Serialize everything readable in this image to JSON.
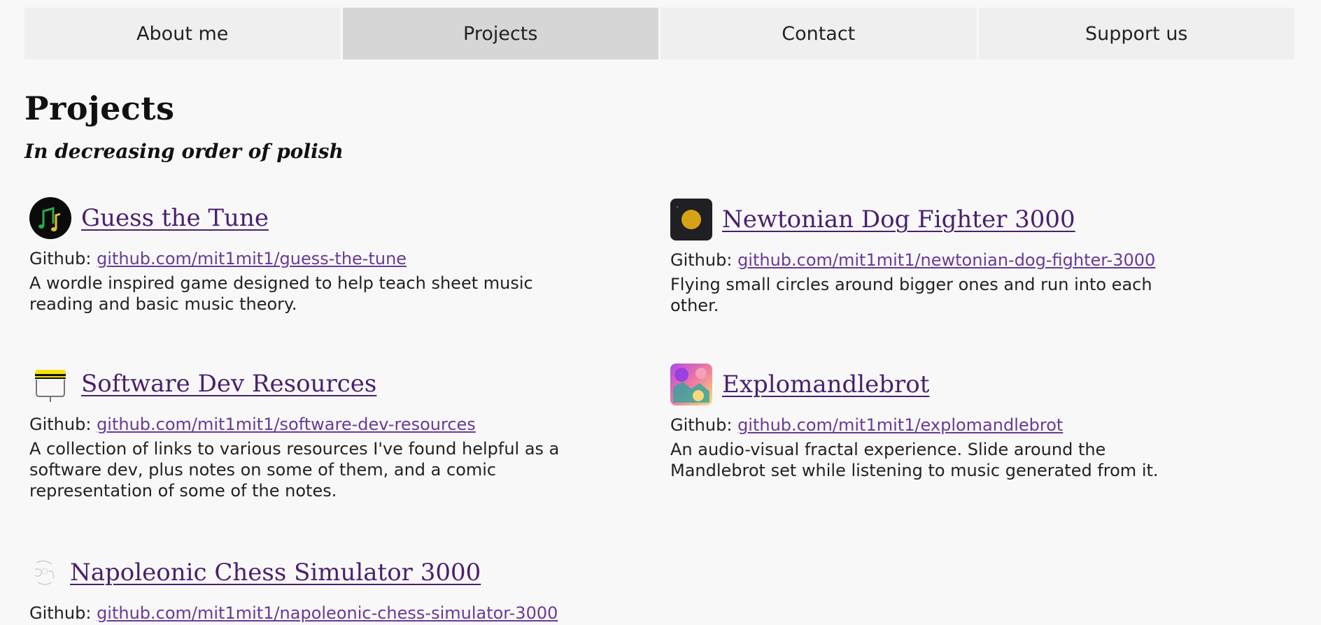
{
  "nav": {
    "items": [
      {
        "label": "About me"
      },
      {
        "label": "Projects"
      },
      {
        "label": "Contact"
      },
      {
        "label": "Support us"
      }
    ],
    "active_index": 1
  },
  "page": {
    "title": "Projects",
    "subtitle": "In decreasing order of polish"
  },
  "projects": [
    {
      "title": "Guess the Tune",
      "github_label": "Github:",
      "github_link": "github.com/mit1mit1/guess-the-tune",
      "description": "A wordle inspired game designed to help teach sheet music reading and basic music theory.",
      "icon": "music-note-icon"
    },
    {
      "title": "Newtonian Dog Fighter 3000",
      "github_label": "Github:",
      "github_link": "github.com/mit1mit1/newtonian-dog-fighter-3000",
      "description": "Flying small circles around bigger ones and run into each other.",
      "icon": "planet-icon"
    },
    {
      "title": "Software Dev Resources",
      "github_label": "Github:",
      "github_link": "github.com/mit1mit1/software-dev-resources",
      "description": "A collection of links to various resources I've found helpful as a software dev, plus notes on some of them, and a comic representation of some of the notes.",
      "icon": "hard-hat-icon"
    },
    {
      "title": "Explomandlebrot",
      "github_label": "Github:",
      "github_link": "github.com/mit1mit1/explomandlebrot",
      "description": "An audio-visual fractal experience. Slide around the Mandlebrot set while listening to music generated from it.",
      "icon": "fractal-icon"
    },
    {
      "title": "Napoleonic Chess Simulator 3000",
      "github_label": "Github:",
      "github_link": "github.com/mit1mit1/napoleonic-chess-simulator-3000",
      "description": "",
      "icon": "chess-sketch-icon"
    }
  ],
  "colors": {
    "background": "#f8f8f8",
    "nav_bg": "#efefef",
    "nav_active_bg": "#d6d6d6",
    "title_link": "#4a1f6f",
    "body_link": "#6a3a96"
  }
}
